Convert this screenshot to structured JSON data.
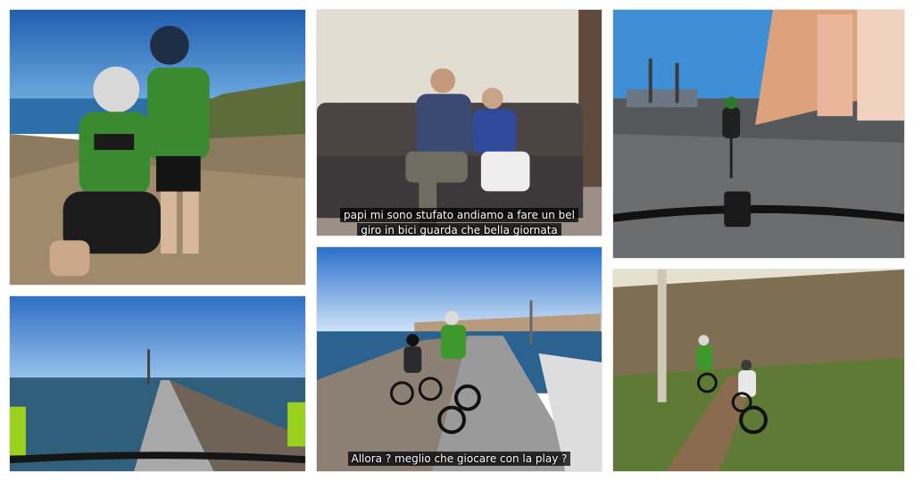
{
  "tiles": [
    {
      "id": "coast-riders",
      "caption": ""
    },
    {
      "id": "sofa-scene",
      "caption": "papi mi sono stufato andiamo a fare un bel giro in bici guarda che bella giornata andiamo ?"
    },
    {
      "id": "promenade-ride",
      "caption": ""
    },
    {
      "id": "pier-pov",
      "caption": ""
    },
    {
      "id": "pier-riders",
      "caption": "Allora ? meglio che giocare con la play ?"
    },
    {
      "id": "forest-trail",
      "caption": ""
    }
  ]
}
